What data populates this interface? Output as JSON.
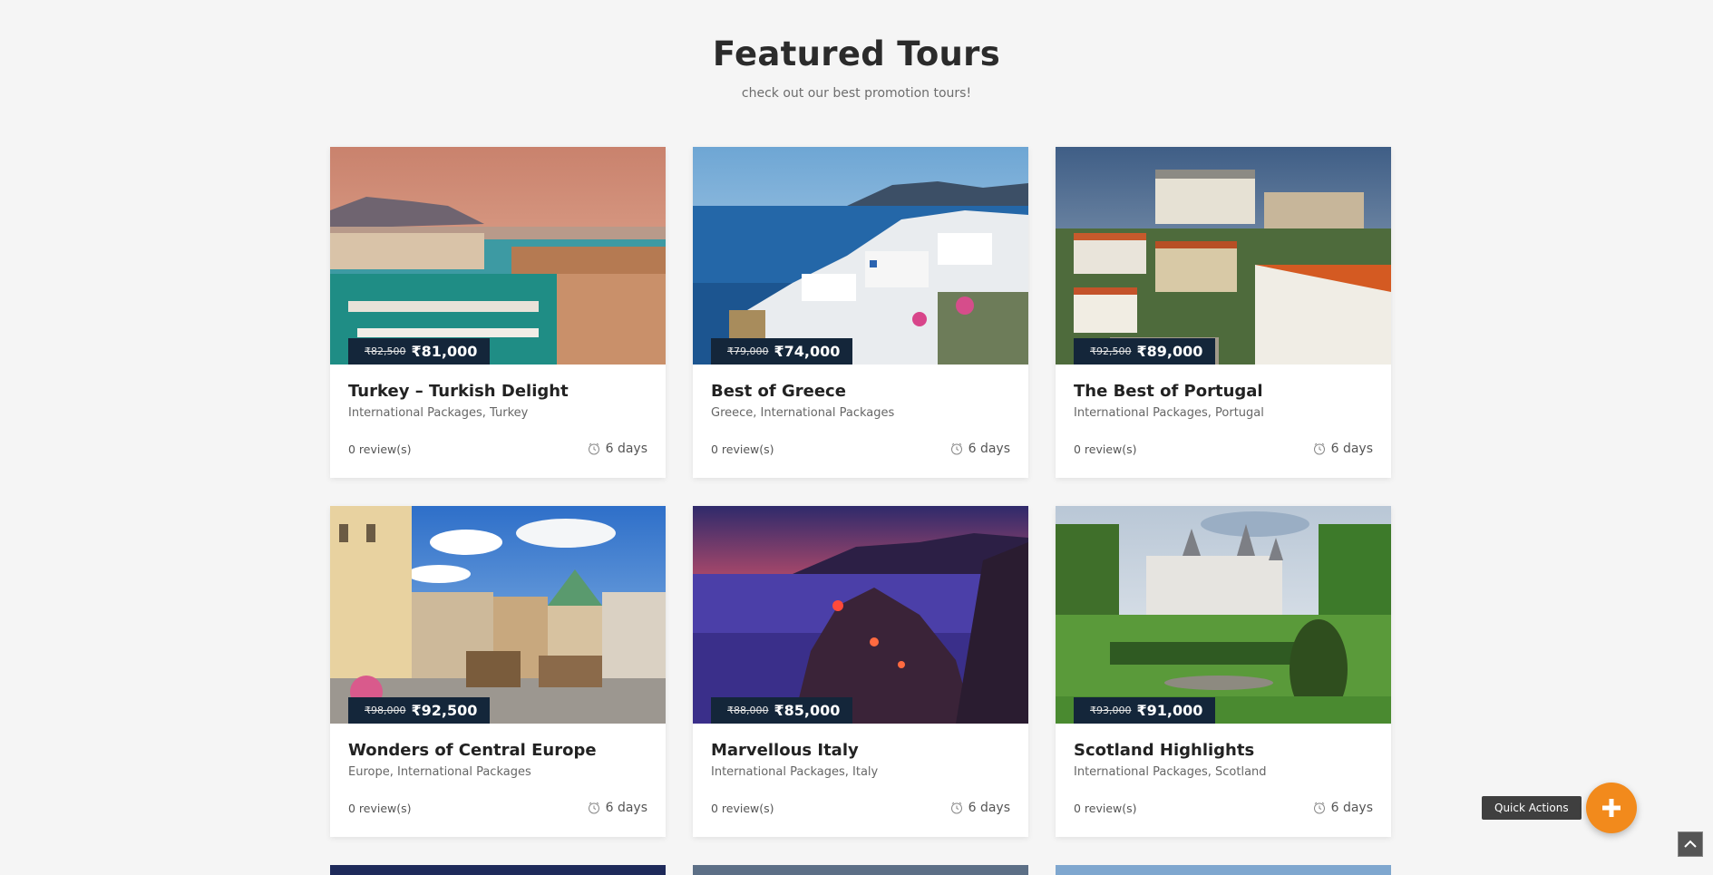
{
  "header": {
    "title": "Featured Tours",
    "subtitle": "check out our best promotion tours!"
  },
  "tours": [
    {
      "title": "Turkey – Turkish Delight",
      "categories": "International Packages, Turkey",
      "old_price": "₹82,500",
      "price": "₹81,000",
      "reviews": "0 review(s)",
      "duration": "6 days"
    },
    {
      "title": "Best of Greece",
      "categories": "Greece, International Packages",
      "old_price": "₹79,000",
      "price": "₹74,000",
      "reviews": "0 review(s)",
      "duration": "6 days"
    },
    {
      "title": "The Best of Portugal",
      "categories": "International Packages, Portugal",
      "old_price": "₹92,500",
      "price": "₹89,000",
      "reviews": "0 review(s)",
      "duration": "6 days"
    },
    {
      "title": "Wonders of Central Europe",
      "categories": "Europe, International Packages",
      "old_price": "₹98,000",
      "price": "₹92,500",
      "reviews": "0 review(s)",
      "duration": "6 days"
    },
    {
      "title": "Marvellous Italy",
      "categories": "International Packages, Italy",
      "old_price": "₹88,000",
      "price": "₹85,000",
      "reviews": "0 review(s)",
      "duration": "6 days"
    },
    {
      "title": "Scotland Highlights",
      "categories": "International Packages, Scotland",
      "old_price": "₹93,000",
      "price": "₹91,000",
      "reviews": "0 review(s)",
      "duration": "6 days"
    }
  ],
  "quick_actions": {
    "label": "Quick Actions",
    "icon": "plus-icon"
  },
  "scroll_top": {
    "icon": "chevron-up-icon"
  },
  "colors": {
    "badge": "#14263a",
    "accent": "#f28a1c",
    "background": "#f5f5f5"
  }
}
